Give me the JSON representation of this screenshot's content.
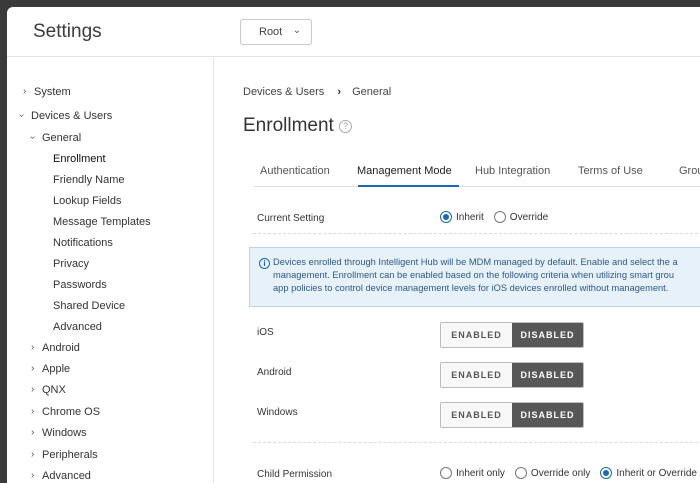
{
  "app": {
    "title": "Settings"
  },
  "org_selector": {
    "value": "Root"
  },
  "sidebar": {
    "items": [
      {
        "label": "System",
        "level": 0,
        "caret": "›"
      },
      {
        "label": "Devices & Users",
        "level": 0,
        "caret": "›",
        "expanded": true
      },
      {
        "label": "General",
        "level": 1,
        "caret": "›",
        "expanded": true
      },
      {
        "label": "Enrollment",
        "level": 2,
        "active": true
      },
      {
        "label": "Friendly Name",
        "level": 2
      },
      {
        "label": "Lookup Fields",
        "level": 2
      },
      {
        "label": "Message Templates",
        "level": 2
      },
      {
        "label": "Notifications",
        "level": 2
      },
      {
        "label": "Privacy",
        "level": 2
      },
      {
        "label": "Passwords",
        "level": 2
      },
      {
        "label": "Shared Device",
        "level": 2
      },
      {
        "label": "Advanced",
        "level": 2
      },
      {
        "label": "Android",
        "level": 1,
        "caret": "›"
      },
      {
        "label": "Apple",
        "level": 1,
        "caret": "›"
      },
      {
        "label": "QNX",
        "level": 1,
        "caret": "›"
      },
      {
        "label": "Chrome OS",
        "level": 1,
        "caret": "›"
      },
      {
        "label": "Windows",
        "level": 1,
        "caret": "›"
      },
      {
        "label": "Peripherals",
        "level": 1,
        "caret": "›"
      },
      {
        "label": "Advanced",
        "level": 1,
        "caret": "›"
      }
    ]
  },
  "breadcrumb": {
    "parent": "Devices & Users",
    "current": "General"
  },
  "page": {
    "title": "Enrollment"
  },
  "tabs": [
    {
      "label": "Authentication"
    },
    {
      "label": "Management Mode",
      "active": true
    },
    {
      "label": "Hub Integration"
    },
    {
      "label": "Terms of Use"
    },
    {
      "label": "Grou"
    }
  ],
  "current_setting": {
    "label": "Current Setting",
    "options": [
      {
        "label": "Inherit",
        "selected": true
      },
      {
        "label": "Override",
        "selected": false
      }
    ]
  },
  "info": {
    "lines": [
      "Devices enrolled through Intelligent Hub will be MDM managed by default. Enable and select the a",
      "management. Enrollment can be enabled based on the following criteria when utilizing smart grou",
      "app policies to control device management levels for iOS devices enrolled without management."
    ]
  },
  "platforms": [
    {
      "label": "iOS",
      "enabled_label": "ENABLED",
      "disabled_label": "DISABLED",
      "selected": "disabled"
    },
    {
      "label": "Android",
      "enabled_label": "ENABLED",
      "disabled_label": "DISABLED",
      "selected": "disabled"
    },
    {
      "label": "Windows",
      "enabled_label": "ENABLED",
      "disabled_label": "DISABLED",
      "selected": "disabled"
    }
  ],
  "child_permission": {
    "label": "Child Permission",
    "options": [
      {
        "label": "Inherit only",
        "selected": false
      },
      {
        "label": "Override only",
        "selected": false
      },
      {
        "label": "Inherit or Override",
        "selected": true
      }
    ]
  },
  "colors": {
    "accent": "#1d66b4",
    "toggle_selected": "#575757",
    "info_bg": "#e6f1fa"
  }
}
